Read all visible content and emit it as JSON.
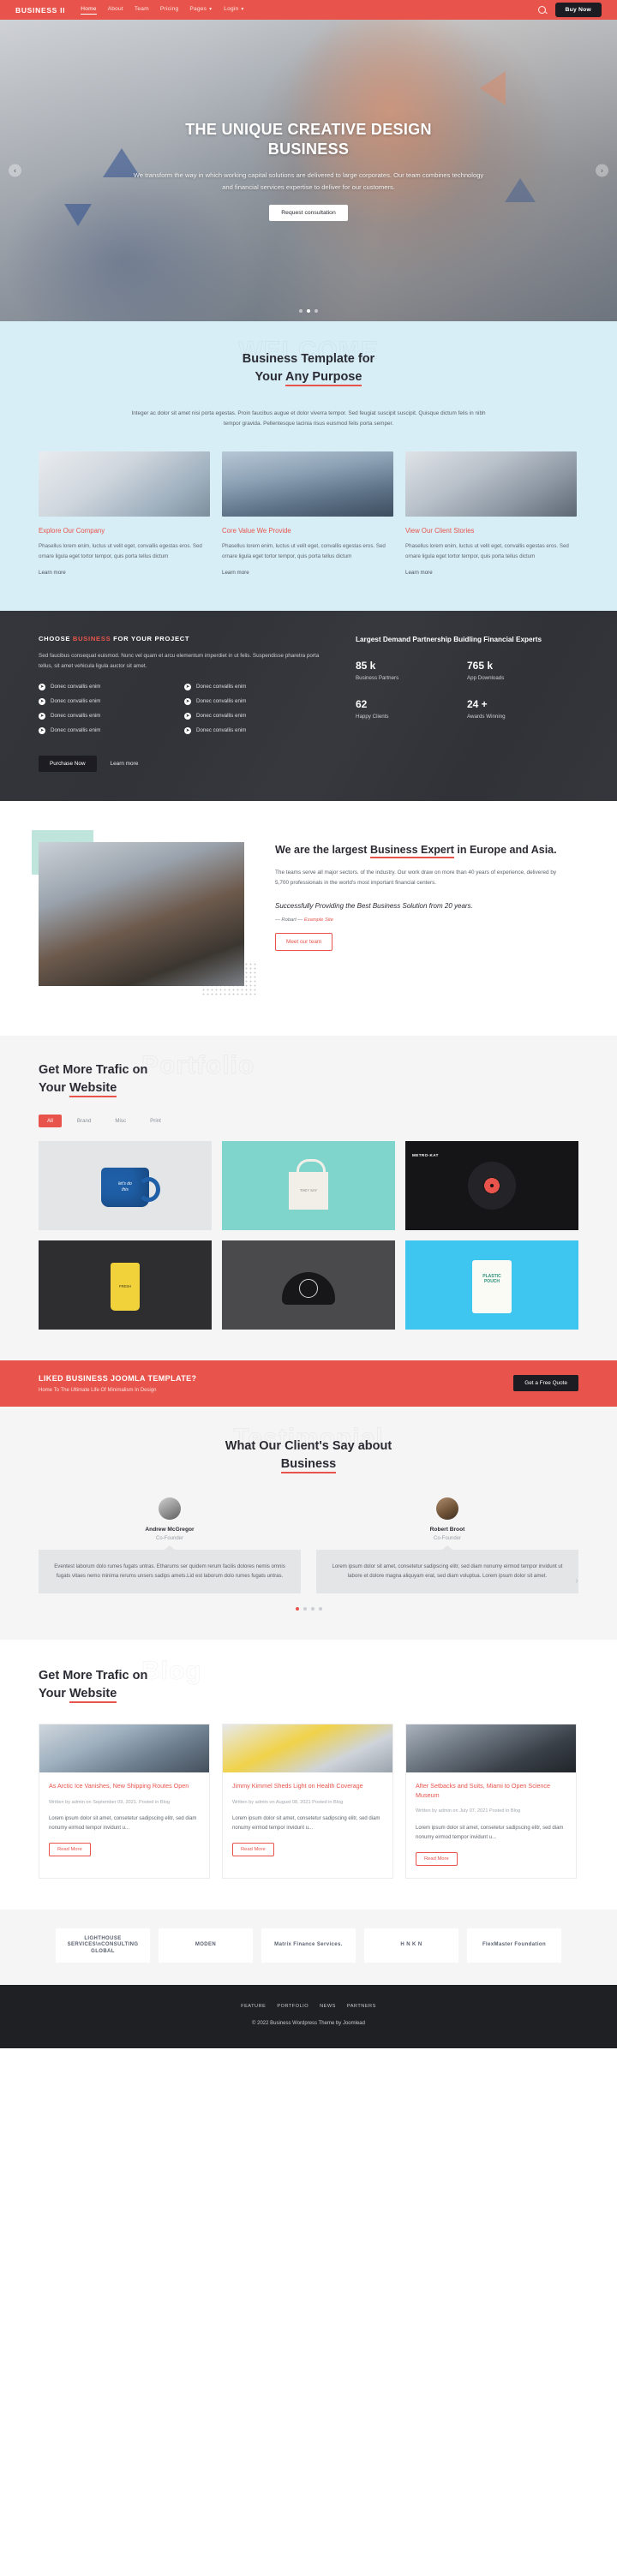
{
  "header": {
    "brand": "BUSINESS II",
    "nav": [
      {
        "label": "Home",
        "active": true,
        "caret": false
      },
      {
        "label": "About",
        "active": false,
        "caret": false
      },
      {
        "label": "Team",
        "active": false,
        "caret": false
      },
      {
        "label": "Pricing",
        "active": false,
        "caret": false
      },
      {
        "label": "Pages",
        "active": false,
        "caret": true
      },
      {
        "label": "Login",
        "active": false,
        "caret": true
      }
    ],
    "search_icon": "search-icon",
    "buy_label": "Buy Now"
  },
  "hero": {
    "title_line1": "THE UNIQUE CREATIVE DESIGN",
    "title_line2": "BUSINESS",
    "subtitle": "We transform the way in which working capital solutions are delivered to large corporates. Our team combines technology and financial services expertise to deliver for our customers.",
    "button": "Request consultation",
    "prev_icon": "chevron-left-icon",
    "next_icon": "chevron-right-icon",
    "slides": 3,
    "active_slide": 2
  },
  "welcome": {
    "ghost": "WELCOME",
    "title_line1": "Business Template for",
    "title_pre": "Your ",
    "title_hl": "Any Purpose",
    "paragraph": "Integer ac dolor sit amet nisi porta egestas. Proin faucibus augue et dolor viverra tempor. Sed feugiat suscipit suscipit. Quisque dictum felis in nibh tempor gravida. Pellentesque lacinia risus euismod felis porta semper.",
    "cards": [
      {
        "title": "Explore Our Company",
        "text": "Phasellus lorem enim, luctus ut velit eget, convallis egestas eros. Sed ornare ligula eget tortor tempor, quis porta tellus dictum",
        "link": "Learn more"
      },
      {
        "title": "Core Value We Provide",
        "text": "Phasellus lorem enim, luctus ut velit eget, convallis egestas eros. Sed ornare ligula eget tortor tempor, quis porta tellus dictum",
        "link": "Learn more"
      },
      {
        "title": "View Our Client Stories",
        "text": "Phasellus lorem enim, luctus ut velit eget, convallis egestas eros. Sed ornare ligula eget tortor tempor, quis porta tellus dictum",
        "link": "Learn more"
      }
    ]
  },
  "dark": {
    "heading_pre": "CHOOSE ",
    "heading_hl": "BUSINESS",
    "heading_post": " FOR YOUR PROJECT",
    "paragraph": "Sed faucibus consequat euismod. Nunc vel quam et arcu elementum imperdiet in ut felis. Suspendisse pharetra porta tellus, sit amet vehicula ligula auctor sit amet.",
    "list": [
      "Donec convallis enim",
      "Donec convallis enim",
      "Donec convallis enim",
      "Donec convallis enim",
      "Donec convallis enim",
      "Donec convallis enim",
      "Donec convallis enim",
      "Donec convallis enim"
    ],
    "purchase_label": "Purchase Now",
    "learn_label": "Learn more",
    "stats_heading": "Largest Demand Partnership Buidling Financial Experts",
    "stats": [
      {
        "num": "85 k",
        "label": "Business Partners"
      },
      {
        "num": "765 k",
        "label": "App Downloads"
      },
      {
        "num": "62",
        "label": "Happy Clients"
      },
      {
        "num": "24 +",
        "label": "Awards Winning"
      }
    ]
  },
  "about": {
    "heading_pre": "We are the largest ",
    "heading_hl": "Business Expert",
    "heading_post": " in Europe and Asia.",
    "paragraph": "The teams serve all major sectors. of the industry. Our work draw on more than 40 years of experience, delivered by 5,700 professionals in the world's most important financial centers.",
    "quote": "Successfully Providing the Best Business Solution from 20 years.",
    "cite_name": "— Robart —",
    "cite_site": "Example Site",
    "button": "Meet our team"
  },
  "portfolio": {
    "ghost": "Portfolio",
    "title_line1": "Get More Trafic on",
    "title_pre": "Your ",
    "title_hl": "Website",
    "filters": [
      {
        "label": "All",
        "active": true
      },
      {
        "label": "Brand",
        "active": false
      },
      {
        "label": "Misc",
        "active": false
      },
      {
        "label": "Print",
        "active": false
      }
    ],
    "items": [
      {
        "name": "blue-mug",
        "caption": "let's do\\nthis"
      },
      {
        "name": "canvas-tote-bag",
        "caption": "THEY SAY"
      },
      {
        "name": "vinyl-record",
        "caption": "METRO-KAT"
      },
      {
        "name": "yellow-coffee-cup",
        "caption": "FRESH"
      },
      {
        "name": "black-cap",
        "caption": ""
      },
      {
        "name": "plastic-pouch",
        "caption": "PLASTIC\\nPOUCH"
      }
    ]
  },
  "cta": {
    "heading": "LIKED BUSINESS JOOMLA TEMPLATE?",
    "subheading": "Home To The Ultimate Life Of Minimalism In Design",
    "button": "Get a Free Quote"
  },
  "testimonial": {
    "ghost": "Testimonial",
    "title_line1": "What Our Client's Say about",
    "title_hl": "Business",
    "prev_icon": "chevron-left-icon",
    "next_icon": "chevron-right-icon",
    "items": [
      {
        "name": "Andrew McGregor",
        "role": "Co-Founder",
        "text": "Eventest laborum dolo rumes fugats untras. Etharums ser quidem rerum facilis dolores nemis omnis fugats vitaes nemo minima rerums unsers sadips amets.Lid est laborum dolo rumes fugats untras."
      },
      {
        "name": "Robert Broot",
        "role": "Co-Founder",
        "text": "Lorem ipsum dolor sit amet, consetetur sadipscing elitr, sed diam nonumy eirmod tempor invidunt ut labore et dolore magna aliquyam erat, sed diam voluptua. Lorem ipsum dolor sit amet."
      }
    ],
    "dots": 4,
    "active_dot": 1
  },
  "blog": {
    "ghost": "Blog",
    "title_line1": "Get More Trafic on",
    "title_pre": "Your ",
    "title_hl": "Website",
    "posts": [
      {
        "title": "As Arctic Ice Vanishes, New Shipping Routes Open",
        "meta": "Written by admin on September 09, 2021. Posted in Blog",
        "excerpt": "Lorem ipsum dolor sit amet, consetetur sadipscing elitr, sed diam nonumy eirmod tempor invidunt u...",
        "button": "Read More"
      },
      {
        "title": "Jimmy Kimmel Sheds Light on Health Coverage",
        "meta": "Written by admin on August 08, 2021 Posted in Blog",
        "excerpt": "Lorem ipsum dolor sit amet, consetetur sadipscing elitr, sed diam nonumy eirmod tempor invidunt u...",
        "button": "Read More"
      },
      {
        "title": "After Setbacks and Suits, Miami to Open Science Museum",
        "meta": "Written by admin on July 07, 2021 Posted in Blog",
        "excerpt": "Lorem ipsum dolor sit amet, consetetur sadipscing elitr, sed diam nonumy eirmod tempor invidunt u...",
        "button": "Read More"
      }
    ]
  },
  "partners": {
    "logos": [
      "LIGHTHOUSE SERVICES\\nCONSULTING GLOBAL",
      "MODEN",
      "Matrix Finance Services.",
      "H N K N",
      "FlexMaster Foundation"
    ]
  },
  "footer": {
    "nav": [
      "FEATURE",
      "PORTFOLIO",
      "NEWS",
      "PARTNERS"
    ],
    "copyright": "© 2022 Business Wordpress Theme by Joomlead"
  },
  "colors": {
    "accent": "#e8544b",
    "dark": "#1f2024",
    "light_blue": "#d8eef7",
    "gray_bg": "#f5f5f6"
  }
}
